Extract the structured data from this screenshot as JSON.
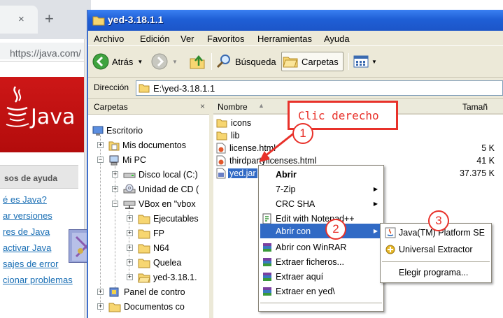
{
  "browser": {
    "tab_close": "×",
    "new_tab": "+",
    "url": "https://java.com/",
    "logo_text": "Java",
    "nav_heading": "sos de ayuda",
    "nav_links": [
      "é es Java?",
      "ar versiones",
      "res de Java",
      "activar Java",
      "sajes de error",
      "cionar problemas"
    ]
  },
  "window": {
    "title": "yed-3.18.1.1",
    "menu": [
      "Archivo",
      "Edición",
      "Ver",
      "Favoritos",
      "Herramientas",
      "Ayuda"
    ],
    "toolbar": {
      "back": "Atrás",
      "search": "Búsqueda",
      "folders": "Carpetas"
    },
    "address": {
      "label": "Dirección",
      "path": "E:\\yed-3.18.1.1"
    }
  },
  "folders_pane": {
    "title": "Carpetas",
    "close": "×",
    "tree": [
      {
        "label": "Escritorio",
        "icon": "desktop-icon"
      },
      {
        "label": "Mis documentos",
        "icon": "documents-icon"
      },
      {
        "label": "Mi PC",
        "icon": "computer-icon"
      },
      {
        "label": "Disco local (C:)",
        "icon": "drive-icon"
      },
      {
        "label": "Unidad de CD (",
        "icon": "cd-drive-icon"
      },
      {
        "label": "VBox en \"vbox",
        "icon": "network-drive-icon"
      },
      {
        "label": "Ejecutables",
        "icon": "folder-icon"
      },
      {
        "label": "FP",
        "icon": "folder-icon"
      },
      {
        "label": "N64",
        "icon": "folder-icon"
      },
      {
        "label": "Quelea",
        "icon": "folder-icon"
      },
      {
        "label": "yed-3.18.1.",
        "icon": "folder-open-icon"
      },
      {
        "label": "Panel de contro",
        "icon": "control-panel-icon"
      },
      {
        "label": "Documentos co",
        "icon": "folder-icon"
      }
    ]
  },
  "files_pane": {
    "columns": {
      "name": "Nombre",
      "sort": "▲",
      "size": "Tamañ"
    },
    "files": [
      {
        "name": "icons",
        "size": ""
      },
      {
        "name": "lib",
        "size": ""
      },
      {
        "name": "license.html",
        "size": "5 K"
      },
      {
        "name": "thirdpartylicenses.html",
        "size": "41 K"
      },
      {
        "name": "yed.jar",
        "size": "37.375 K"
      }
    ]
  },
  "context_menu": {
    "items": [
      "Abrir",
      "7-Zip",
      "CRC SHA",
      "Edit with Notepad++",
      "Abrir con",
      "Abrir con WinRAR",
      "Extraer ficheros...",
      "Extraer aquí",
      "Extraer en yed\\"
    ],
    "submenu_arrow": "▶"
  },
  "open_with_menu": {
    "items": [
      "Java(TM) Platform SE",
      "Universal Extractor",
      "Elegir programa..."
    ]
  },
  "annotations": {
    "callout": "Clic derecho",
    "steps": [
      "1",
      "2",
      "3"
    ],
    "accent_color": "#e8312a"
  },
  "colors": {
    "titlebar": "#1f5fd6",
    "selection": "#316ac5",
    "chrome": "#ece9d8"
  }
}
